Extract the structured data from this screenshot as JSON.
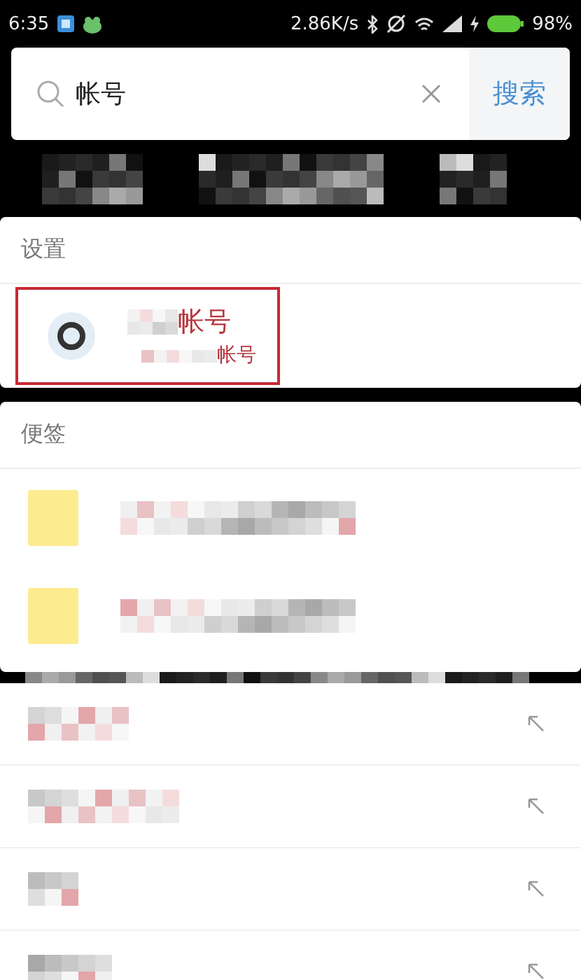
{
  "status_bar": {
    "time": "6:35",
    "net_speed": "2.86K/s",
    "battery": "98%"
  },
  "search": {
    "value": "帐号",
    "button": "搜索"
  },
  "settings_section": {
    "title": "设置",
    "results": [
      {
        "title": "帐号",
        "subtitle": "帐号",
        "highlighted": true
      }
    ]
  },
  "notes_section": {
    "title": "便签",
    "notes": [
      {
        "kind": "note"
      },
      {
        "kind": "note"
      }
    ]
  },
  "suggestions": [
    {
      "kind": "history"
    },
    {
      "kind": "history"
    },
    {
      "kind": "history"
    },
    {
      "kind": "history"
    }
  ]
}
